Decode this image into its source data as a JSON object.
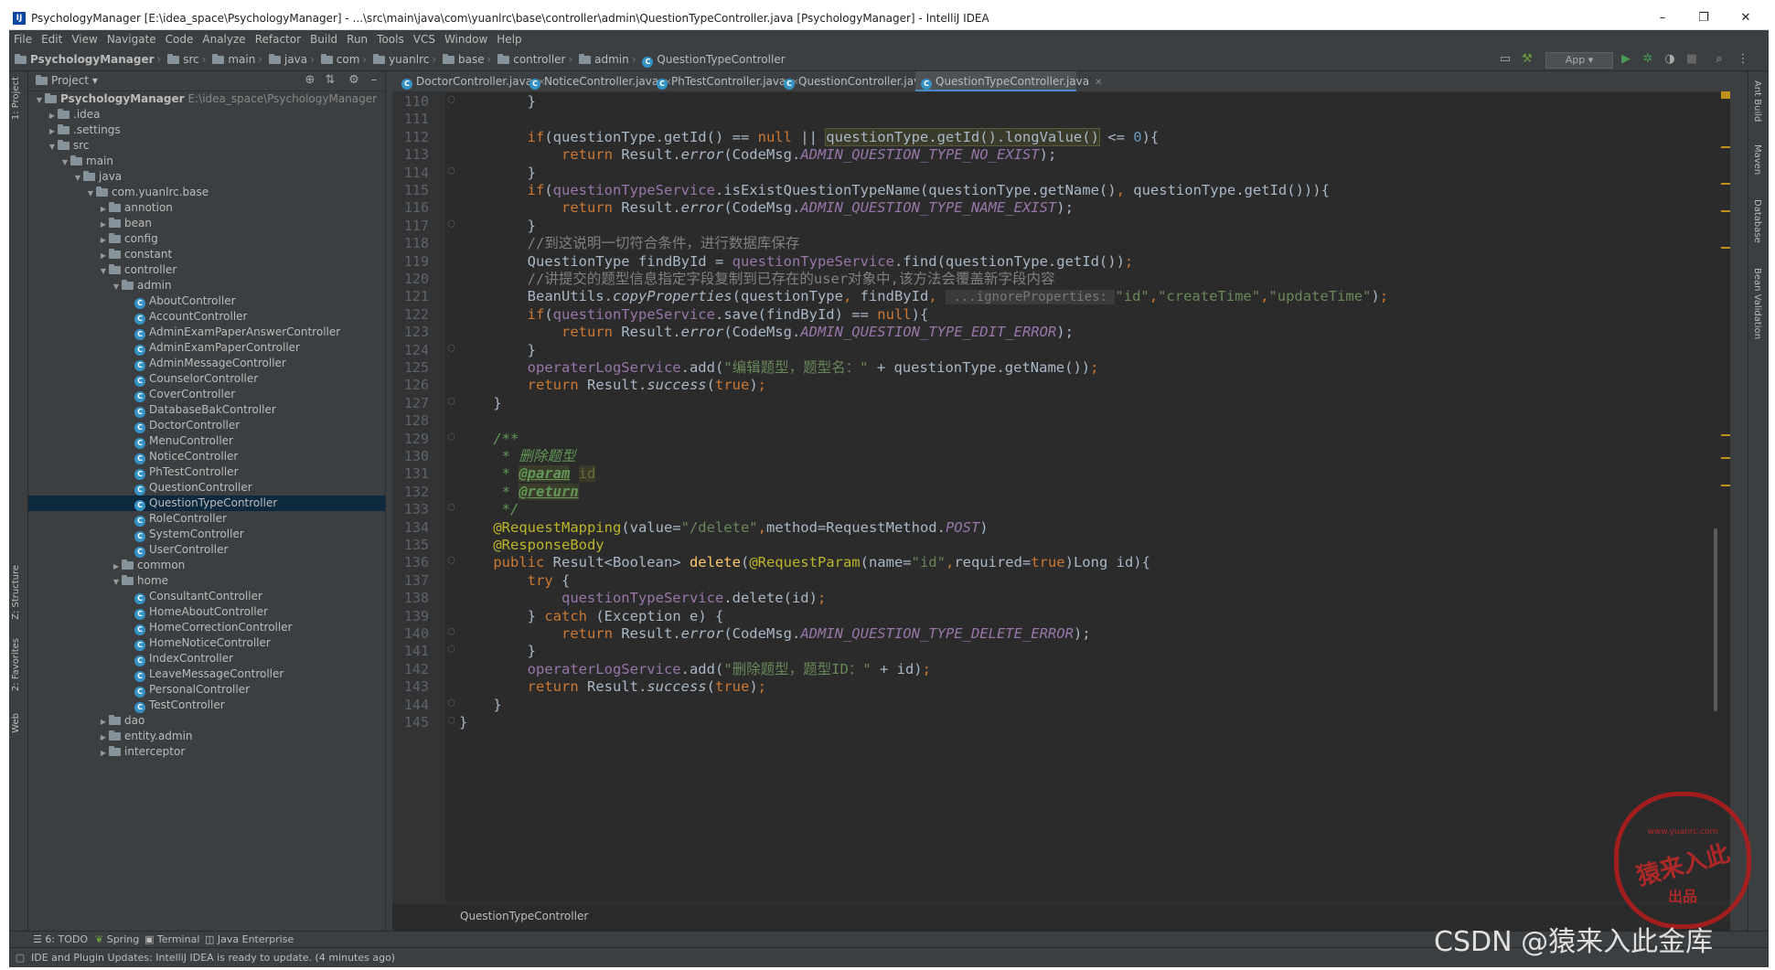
{
  "window": {
    "title": "PsychologyManager [E:\\idea_space\\PsychologyManager] - ...\\src\\main\\java\\com\\yuanlrc\\base\\controller\\admin\\QuestionTypeController.java [PsychologyManager] - IntelliJ IDEA",
    "minimize": "–",
    "maximize": "❐",
    "close": "✕"
  },
  "menu": [
    "File",
    "Edit",
    "View",
    "Navigate",
    "Code",
    "Analyze",
    "Refactor",
    "Build",
    "Run",
    "Tools",
    "VCS",
    "Window",
    "Help"
  ],
  "breadcrumb": [
    "PsychologyManager",
    "src",
    "main",
    "java",
    "com",
    "yuanlrc",
    "base",
    "controller",
    "admin",
    "QuestionTypeController"
  ],
  "toolbar": {
    "run_config": "App"
  },
  "project_panel": {
    "title": "Project",
    "tree": [
      {
        "label": "PsychologyManager",
        "path": "E:\\idea_space\\PsychologyManager",
        "depth": 0,
        "type": "module",
        "expanded": true
      },
      {
        "label": ".idea",
        "depth": 1,
        "type": "folder",
        "expanded": false
      },
      {
        "label": ".settings",
        "depth": 1,
        "type": "folder",
        "expanded": false
      },
      {
        "label": "src",
        "depth": 1,
        "type": "folder",
        "expanded": true
      },
      {
        "label": "main",
        "depth": 2,
        "type": "folder",
        "expanded": true
      },
      {
        "label": "java",
        "depth": 3,
        "type": "folder",
        "expanded": true
      },
      {
        "label": "com.yuanlrc.base",
        "depth": 4,
        "type": "package",
        "expanded": true
      },
      {
        "label": "annotion",
        "depth": 5,
        "type": "package",
        "expanded": false
      },
      {
        "label": "bean",
        "depth": 5,
        "type": "package",
        "expanded": false
      },
      {
        "label": "config",
        "depth": 5,
        "type": "package",
        "expanded": false
      },
      {
        "label": "constant",
        "depth": 5,
        "type": "package",
        "expanded": false
      },
      {
        "label": "controller",
        "depth": 5,
        "type": "package",
        "expanded": true
      },
      {
        "label": "admin",
        "depth": 6,
        "type": "package",
        "expanded": true
      },
      {
        "label": "AboutController",
        "depth": 7,
        "type": "class"
      },
      {
        "label": "AccountController",
        "depth": 7,
        "type": "class"
      },
      {
        "label": "AdminExamPaperAnswerController",
        "depth": 7,
        "type": "class"
      },
      {
        "label": "AdminExamPaperController",
        "depth": 7,
        "type": "class"
      },
      {
        "label": "AdminMessageController",
        "depth": 7,
        "type": "class"
      },
      {
        "label": "CounselorController",
        "depth": 7,
        "type": "class"
      },
      {
        "label": "CoverController",
        "depth": 7,
        "type": "class"
      },
      {
        "label": "DatabaseBakController",
        "depth": 7,
        "type": "class"
      },
      {
        "label": "DoctorController",
        "depth": 7,
        "type": "class"
      },
      {
        "label": "MenuController",
        "depth": 7,
        "type": "class"
      },
      {
        "label": "NoticeController",
        "depth": 7,
        "type": "class"
      },
      {
        "label": "PhTestController",
        "depth": 7,
        "type": "class"
      },
      {
        "label": "QuestionController",
        "depth": 7,
        "type": "class"
      },
      {
        "label": "QuestionTypeController",
        "depth": 7,
        "type": "class",
        "selected": true
      },
      {
        "label": "RoleController",
        "depth": 7,
        "type": "class"
      },
      {
        "label": "SystemController",
        "depth": 7,
        "type": "class"
      },
      {
        "label": "UserController",
        "depth": 7,
        "type": "class"
      },
      {
        "label": "common",
        "depth": 6,
        "type": "package",
        "expanded": false
      },
      {
        "label": "home",
        "depth": 6,
        "type": "package",
        "expanded": true
      },
      {
        "label": "ConsultantController",
        "depth": 7,
        "type": "class"
      },
      {
        "label": "HomeAboutController",
        "depth": 7,
        "type": "class"
      },
      {
        "label": "HomeCorrectionController",
        "depth": 7,
        "type": "class"
      },
      {
        "label": "HomeNoticeController",
        "depth": 7,
        "type": "class"
      },
      {
        "label": "IndexController",
        "depth": 7,
        "type": "class"
      },
      {
        "label": "LeaveMessageController",
        "depth": 7,
        "type": "class"
      },
      {
        "label": "PersonalController",
        "depth": 7,
        "type": "class"
      },
      {
        "label": "TestController",
        "depth": 7,
        "type": "class"
      },
      {
        "label": "dao",
        "depth": 5,
        "type": "package",
        "expanded": false
      },
      {
        "label": "entity.admin",
        "depth": 5,
        "type": "package",
        "expanded": false
      },
      {
        "label": "interceptor",
        "depth": 5,
        "type": "package",
        "expanded": false
      }
    ]
  },
  "editor_tabs": [
    {
      "label": "DoctorController.java",
      "active": false
    },
    {
      "label": "NoticeController.java",
      "active": false
    },
    {
      "label": "PhTestController.java",
      "active": false
    },
    {
      "label": "QuestionController.java",
      "active": false
    },
    {
      "label": "QuestionTypeController.java",
      "active": true
    }
  ],
  "code": {
    "first_line": 110,
    "lines": [
      [
        [
          "        }",
          "p"
        ]
      ],
      [],
      [
        [
          "        ",
          "p"
        ],
        [
          "if",
          "kw"
        ],
        [
          "(questionType.getId() == ",
          "p"
        ],
        [
          "null",
          "kw"
        ],
        [
          " || ",
          "p"
        ],
        [
          "questionType.getId().longValue()",
          "hl"
        ],
        [
          " <= ",
          "p"
        ],
        [
          "0",
          "nm"
        ],
        [
          ")",
          "p"
        ],
        [
          "{",
          "p"
        ]
      ],
      [
        [
          "            ",
          "p"
        ],
        [
          "return",
          "kw"
        ],
        [
          " Result.",
          "p"
        ],
        [
          "error",
          "it"
        ],
        [
          "(CodeMsg.",
          "p"
        ],
        [
          "ADMIN_QUESTION_TYPE_NO_EXIST",
          "cst"
        ],
        [
          ");",
          "p"
        ]
      ],
      [
        [
          "        }",
          "p"
        ]
      ],
      [
        [
          "        ",
          "p"
        ],
        [
          "if",
          "kw"
        ],
        [
          "(",
          "p"
        ],
        [
          "questionTypeService",
          "fld"
        ],
        [
          ".isExistQuestionTypeName(questionType.getName()",
          "p"
        ],
        [
          ", ",
          "kw"
        ],
        [
          "questionType.getId()))",
          "p"
        ],
        [
          "{",
          "p"
        ]
      ],
      [
        [
          "            ",
          "p"
        ],
        [
          "return",
          "kw"
        ],
        [
          " Result.",
          "p"
        ],
        [
          "error",
          "it"
        ],
        [
          "(CodeMsg.",
          "p"
        ],
        [
          "ADMIN_QUESTION_TYPE_NAME_EXIST",
          "cst"
        ],
        [
          ");",
          "p"
        ]
      ],
      [
        [
          "        }",
          "p"
        ]
      ],
      [
        [
          "        ",
          "p"
        ],
        [
          "//到这说明一切符合条件，进行数据库保存",
          "cm"
        ]
      ],
      [
        [
          "        QuestionType findById = ",
          "p"
        ],
        [
          "questionTypeService",
          "fld"
        ],
        [
          ".find(questionType.getId())",
          "p"
        ],
        [
          ";",
          "kw"
        ]
      ],
      [
        [
          "        ",
          "p"
        ],
        [
          "//讲提交的题型信息指定字段复制到已存在的user对象中,该方法会覆盖新字段内容",
          "cm"
        ]
      ],
      [
        [
          "        BeanUtils.",
          "p"
        ],
        [
          "copyProperties",
          "it"
        ],
        [
          "(questionType",
          "p"
        ],
        [
          ", ",
          "kw"
        ],
        [
          "findById",
          "p"
        ],
        [
          ", ",
          "kw"
        ],
        [
          " ...ignoreProperties: ",
          "hint"
        ],
        [
          "\"id\"",
          "st"
        ],
        [
          ",",
          "kw"
        ],
        [
          "\"createTime\"",
          "st"
        ],
        [
          ",",
          "kw"
        ],
        [
          "\"updateTime\"",
          "st"
        ],
        [
          ")",
          "p"
        ],
        [
          ";",
          "kw"
        ]
      ],
      [
        [
          "        ",
          "p"
        ],
        [
          "if",
          "kw"
        ],
        [
          "(",
          "p"
        ],
        [
          "questionTypeService",
          "fld"
        ],
        [
          ".save(findById) == ",
          "p"
        ],
        [
          "null",
          "kw"
        ],
        [
          ")",
          "p"
        ],
        [
          "{",
          "p"
        ]
      ],
      [
        [
          "            ",
          "p"
        ],
        [
          "return",
          "kw"
        ],
        [
          " Result.",
          "p"
        ],
        [
          "error",
          "it"
        ],
        [
          "(CodeMsg.",
          "p"
        ],
        [
          "ADMIN_QUESTION_TYPE_EDIT_ERROR",
          "cst"
        ],
        [
          ");",
          "p"
        ]
      ],
      [
        [
          "        }",
          "p"
        ]
      ],
      [
        [
          "        ",
          "p"
        ],
        [
          "operaterLogService",
          "fld"
        ],
        [
          ".add(",
          "p"
        ],
        [
          "\"编辑题型，题型名：\"",
          "st"
        ],
        [
          " + questionType.getName())",
          "p"
        ],
        [
          ";",
          "kw"
        ]
      ],
      [
        [
          "        ",
          "p"
        ],
        [
          "return",
          "kw"
        ],
        [
          " Result.",
          "p"
        ],
        [
          "success",
          "it"
        ],
        [
          "(",
          "p"
        ],
        [
          "true",
          "kw"
        ],
        [
          ")",
          "p"
        ],
        [
          ";",
          "kw"
        ]
      ],
      [
        [
          "    }",
          "p"
        ]
      ],
      [],
      [
        [
          "    ",
          "p"
        ],
        [
          "/**",
          "dc"
        ]
      ],
      [
        [
          "     * 删除题型",
          "dc"
        ]
      ],
      [
        [
          "     * ",
          "dc"
        ],
        [
          "@param",
          "dtag"
        ],
        [
          " ",
          "dc"
        ],
        [
          "id",
          "hidden-id"
        ]
      ],
      [
        [
          "     * ",
          "dc"
        ],
        [
          "@return",
          "dtag"
        ]
      ],
      [
        [
          "     */",
          "dc"
        ]
      ],
      [
        [
          "    ",
          "p"
        ],
        [
          "@RequestMapping",
          "ann"
        ],
        [
          "(value=",
          "p"
        ],
        [
          "\"/delete\"",
          "st"
        ],
        [
          ",",
          "kw"
        ],
        [
          "method=RequestMethod.",
          "p"
        ],
        [
          "POST",
          "cst"
        ],
        [
          ")",
          "p"
        ]
      ],
      [
        [
          "    ",
          "p"
        ],
        [
          "@ResponseBody",
          "ann"
        ]
      ],
      [
        [
          "    ",
          "p"
        ],
        [
          "public",
          "kw"
        ],
        [
          " Result<Boolean> ",
          "p"
        ],
        [
          "delete",
          "fn"
        ],
        [
          "(",
          "p"
        ],
        [
          "@RequestParam",
          "ann"
        ],
        [
          "(name=",
          "p"
        ],
        [
          "\"id\"",
          "st"
        ],
        [
          ",",
          "kw"
        ],
        [
          "required=",
          "p"
        ],
        [
          "true",
          "kw"
        ],
        [
          ")Long id)",
          "p"
        ],
        [
          "{",
          "p"
        ]
      ],
      [
        [
          "        ",
          "p"
        ],
        [
          "try",
          "kw"
        ],
        [
          " {",
          "p"
        ]
      ],
      [
        [
          "            ",
          "p"
        ],
        [
          "questionTypeService",
          "fld"
        ],
        [
          ".delete(id)",
          "p"
        ],
        [
          ";",
          "kw"
        ]
      ],
      [
        [
          "        } ",
          "p"
        ],
        [
          "catch",
          "kw"
        ],
        [
          " (Exception e) {",
          "p"
        ]
      ],
      [
        [
          "            ",
          "p"
        ],
        [
          "return",
          "kw"
        ],
        [
          " Result.",
          "p"
        ],
        [
          "error",
          "it"
        ],
        [
          "(CodeMsg.",
          "p"
        ],
        [
          "ADMIN_QUESTION_TYPE_DELETE_ERROR",
          "cst"
        ],
        [
          ");",
          "p"
        ]
      ],
      [
        [
          "        }",
          "p"
        ]
      ],
      [
        [
          "        ",
          "p"
        ],
        [
          "operaterLogService",
          "fld"
        ],
        [
          ".add(",
          "p"
        ],
        [
          "\"删除题型，题型ID：\"",
          "st"
        ],
        [
          " + id)",
          "p"
        ],
        [
          ";",
          "kw"
        ]
      ],
      [
        [
          "        ",
          "p"
        ],
        [
          "return",
          "kw"
        ],
        [
          " Result.",
          "p"
        ],
        [
          "success",
          "it"
        ],
        [
          "(",
          "p"
        ],
        [
          "true",
          "kw"
        ],
        [
          ")",
          "p"
        ],
        [
          ";",
          "kw"
        ]
      ],
      [
        [
          "    }",
          "p"
        ]
      ],
      [
        [
          "}",
          "p"
        ]
      ]
    ]
  },
  "editor_footer": "QuestionTypeController",
  "left_tool_tabs": [
    "1: Project",
    "Z: Structure",
    "2: Favorites",
    "Web"
  ],
  "right_tool_tabs": [
    "Ant Build",
    "Maven",
    "Database",
    "Bean Validation"
  ],
  "bottom_tools": [
    "6: TODO",
    "Spring",
    "Terminal",
    "Java Enterprise"
  ],
  "status": {
    "message": "IDE and Plugin Updates: IntelliJ IDEA is ready to update. (4 minutes ago)"
  },
  "watermark": "CSDN @猿来入此金库",
  "stamp": {
    "top": "www.yuanrc.com",
    "middle": "猿来入此",
    "bottom": "出品"
  },
  "colors": {
    "selection": "#0d293e",
    "keyword": "#cc7832",
    "string": "#6a8759",
    "field": "#9876aa",
    "annotation": "#bbb529",
    "background": "#2b2b2b"
  }
}
